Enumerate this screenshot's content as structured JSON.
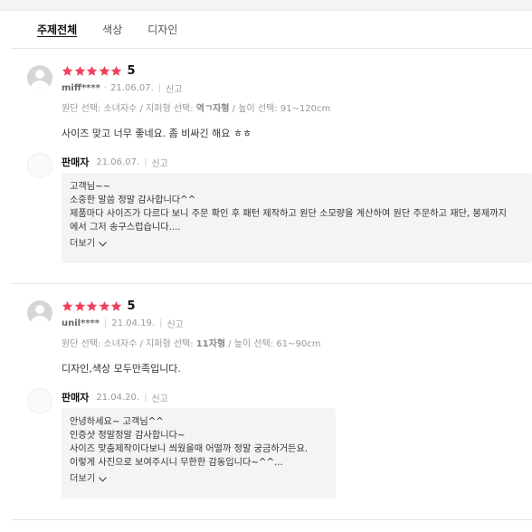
{
  "tabs": [
    {
      "label": "주제전체",
      "active": true
    },
    {
      "label": "색상",
      "active": false
    },
    {
      "label": "디자인",
      "active": false
    }
  ],
  "colors": {
    "star": "#f0415a",
    "accent": "#111111"
  },
  "reviews": [
    {
      "rating": 5,
      "score": "5",
      "user": "miff****",
      "date": "21.06.07.",
      "report": "신고",
      "options_prefix": "원단 선택: 소녀자수 / 지퍼형 선택: ",
      "options_bold": "역ㄱ자형",
      "options_suffix": " / 높이 선택: 91~120cm",
      "body": "사이즈 맞고 너무 좋네요. 좀 비싸긴 해요 ㅎㅎ",
      "seller": {
        "logo_text": "판매자로고",
        "name": "판매자",
        "date": "21.06.07.",
        "report": "신고",
        "lines": [
          "고객님~~",
          "소중한 말씀 정말 감사합니다^^",
          "제품마다 사이즈가 다르다 보니 주문 확인 후 패턴 제작하고 원단 소모량을 계산하여 원단 주문하고 재단, 봉제까지",
          "에서 그저 송구스럽습니다...."
        ],
        "more": "더보기"
      }
    },
    {
      "rating": 5,
      "score": "5",
      "user": "unil****",
      "date": "21.04.19.",
      "report": "신고",
      "options_prefix": "원단 선택: 소녀자수 / 지퍼형 선택: ",
      "options_bold": "11자형",
      "options_suffix": " / 높이 선택: 61~90cm",
      "body": "디자인,색상 모두만족입니다.",
      "seller": {
        "logo_text": "판매자로고",
        "name": "판매자",
        "date": "21.04.20.",
        "report": "신고",
        "lines": [
          "안녕하세요~ 고객님^^",
          "인증샷 정말정말 감사합니다~",
          "사이즈 맞춤제작이다보니 씌웠을때 어떨까 정말 궁금하거든요.",
          "이렇게 사진으로 보여주시니 무한한 감동입니다~^^..."
        ],
        "more": "더보기"
      }
    }
  ]
}
